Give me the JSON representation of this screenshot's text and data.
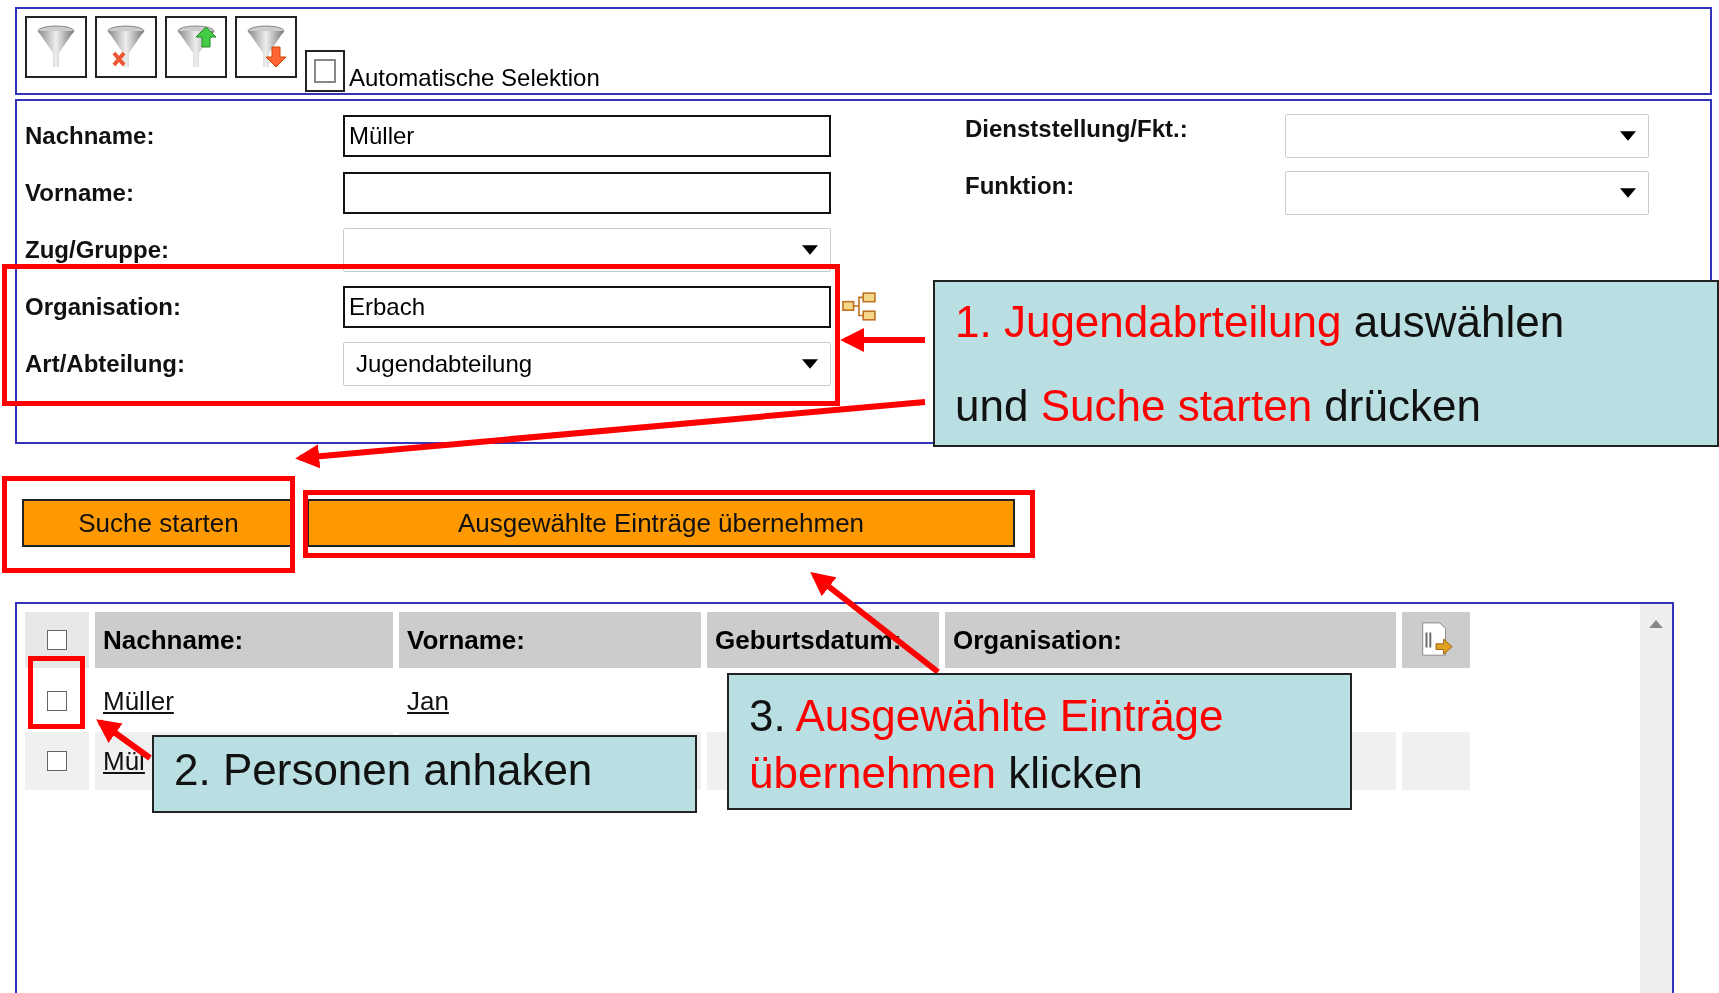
{
  "toolbar": {
    "auto_selection": {
      "label": "Automatische Selektion",
      "checked": false
    }
  },
  "form": {
    "left": [
      {
        "label": "Nachname:",
        "kind": "text",
        "value": "Müller"
      },
      {
        "label": "Vorname:",
        "kind": "text"
      },
      {
        "label": "Zug/Gruppe:",
        "kind": "select"
      },
      {
        "label": "Organisation:",
        "kind": "tree",
        "value": "Erbach"
      },
      {
        "label": "Art/Abteilung:",
        "kind": "select",
        "value": "Jugendabteilung"
      }
    ],
    "right": [
      {
        "label": "Dienststellung/Fkt.:",
        "kind": "select"
      },
      {
        "label": "Funktion:",
        "kind": "select"
      }
    ]
  },
  "actions": [
    {
      "label": "Suche starten"
    },
    {
      "label": "Ausgewählte Einträge übernehmen"
    }
  ],
  "table": {
    "select_all": {
      "checked": false
    },
    "columns": [
      "Nachname:",
      "Vorname:",
      "Geburtsdatum:",
      "Organisation:"
    ],
    "rows": [
      {
        "checked": false,
        "cells": [
          "Müller",
          "Jan"
        ]
      },
      {
        "checked": false,
        "cells": [
          "Mül"
        ]
      }
    ]
  },
  "annotations": [
    {
      "segments": [
        {
          "text": "1. Jugendabrteilung",
          "highlight": true
        },
        {
          "text": " auswählen",
          "highlight": false
        },
        {
          "text": "und ",
          "highlight": false,
          "break": true
        },
        {
          "text": "Suche starten",
          "highlight": true
        },
        {
          "text": " drücken",
          "highlight": false
        }
      ]
    },
    {
      "segments": [
        {
          "text": "2. Personen anhaken",
          "highlight": false
        }
      ]
    },
    {
      "segments": [
        {
          "text": "3. ",
          "highlight": false
        },
        {
          "text": "Ausgewählte Einträge",
          "highlight": true
        },
        {
          "text": "übernehmen",
          "highlight": true,
          "break": true
        },
        {
          "text": " klicken",
          "highlight": false
        }
      ]
    }
  ]
}
